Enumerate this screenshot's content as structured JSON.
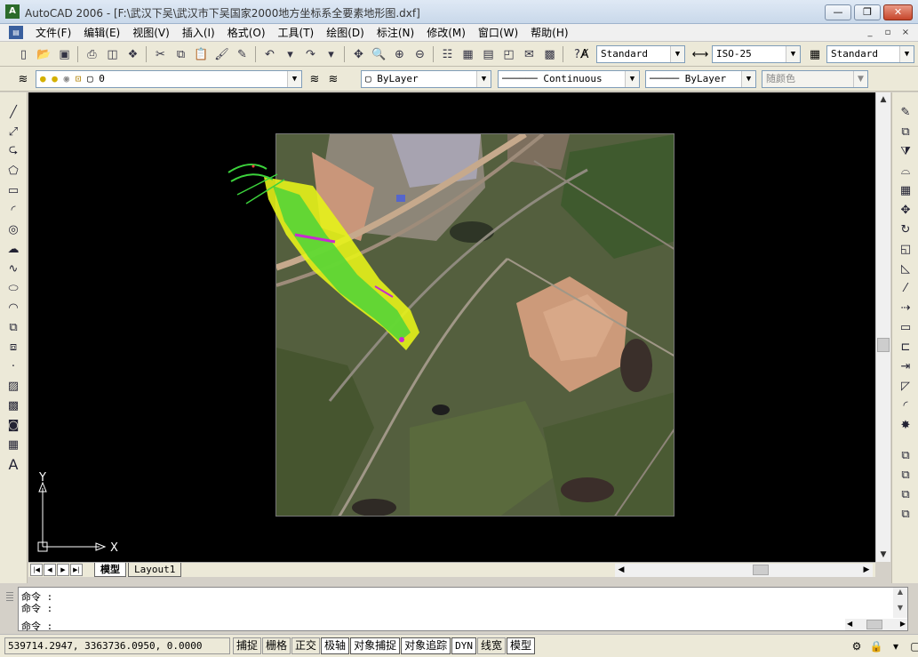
{
  "window": {
    "title": "AutoCAD 2006 - [F:\\武汉下吴\\武汉市下吴国家2000地方坐标系全要素地形图.dxf]",
    "app_icon_text": "A",
    "min_glyph": "—",
    "max_glyph": "❐",
    "close_glyph": "✕"
  },
  "menu": {
    "items": [
      "文件(F)",
      "编辑(E)",
      "视图(V)",
      "插入(I)",
      "格式(O)",
      "工具(T)",
      "绘图(D)",
      "标注(N)",
      "修改(M)",
      "窗口(W)",
      "帮助(H)"
    ],
    "mdi_min": "_",
    "mdi_restore": "▫",
    "mdi_close": "×"
  },
  "toolbar_standard": {
    "text_style": "Standard",
    "dim_style": "ISO-25",
    "table_style": "Standard"
  },
  "toolbar_layers": {
    "current_layer": "0",
    "color": "ByLayer",
    "linetype": "Continuous",
    "lineweight": "ByLayer",
    "plot_style": "随颜色"
  },
  "ucs": {
    "x_label": "X",
    "y_label": "Y"
  },
  "layout_tabs": {
    "model": "模型",
    "layout1": "Layout1"
  },
  "command": {
    "lines": [
      "命令 :",
      "命令 :"
    ],
    "prompt": "命令 :"
  },
  "status": {
    "coordinates": "539714.2947, 3363736.0950, 0.0000",
    "toggles": [
      {
        "label": "捕捉",
        "on": false
      },
      {
        "label": "栅格",
        "on": false
      },
      {
        "label": "正交",
        "on": false
      },
      {
        "label": "极轴",
        "on": true
      },
      {
        "label": "对象捕捉",
        "on": true
      },
      {
        "label": "对象追踪",
        "on": true
      },
      {
        "label": "DYN",
        "on": true
      },
      {
        "label": "线宽",
        "on": false
      },
      {
        "label": "模型",
        "on": true
      }
    ]
  },
  "colors": {
    "canvas_bg": "#000000",
    "contour_yellow": "#e6f21a",
    "contour_green": "#3cd23c",
    "contour_magenta": "#c82bd0"
  }
}
